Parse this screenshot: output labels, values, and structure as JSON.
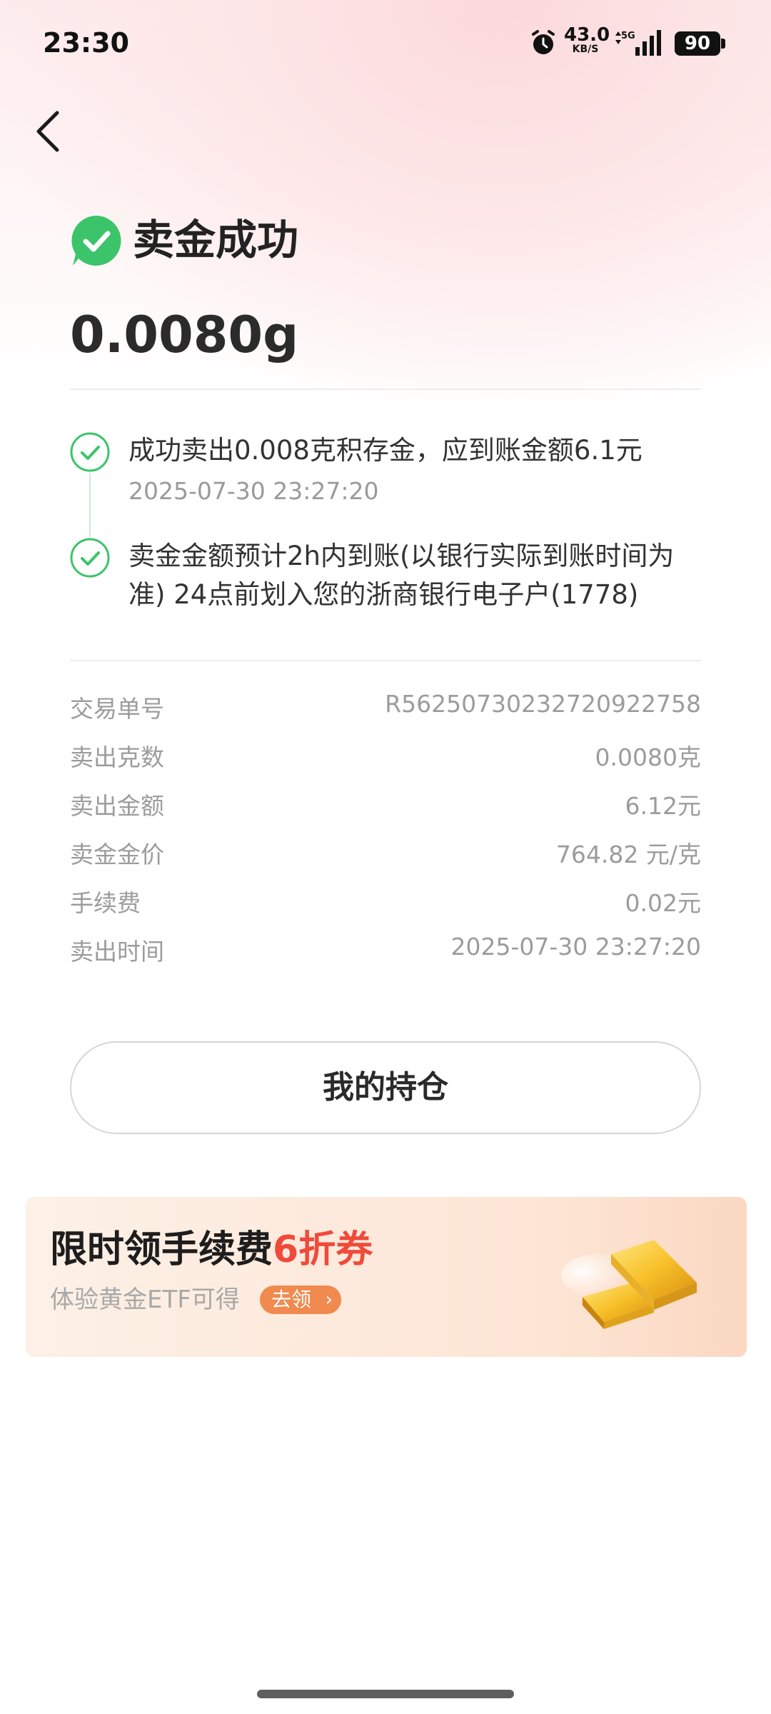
{
  "status_bar": {
    "time": "23:30",
    "net_speed_value": "43.0",
    "net_speed_unit": "KB/S",
    "network_type": "5G",
    "battery": "90"
  },
  "header": {
    "back_icon": "chevron-left-icon"
  },
  "result": {
    "title": "卖金成功",
    "icon": "check-circle-icon",
    "amount": "0.0080g"
  },
  "steps": [
    {
      "text": "成功卖出0.008克积存金，应到账金额6.1元",
      "time": "2025-07-30 23:27:20"
    },
    {
      "text": "卖金金额预计2h内到账(以银行实际到账时间为准) 24点前划入您的浙商银行电子户(1778)"
    }
  ],
  "details": [
    {
      "label": "交易单号",
      "value": "R56250730232720922758"
    },
    {
      "label": "卖出克数",
      "value": "0.0080克"
    },
    {
      "label": "卖出金额",
      "value": "6.12元"
    },
    {
      "label": "卖金金价",
      "value": "764.82 元/克"
    },
    {
      "label": "手续费",
      "value": "0.02元"
    },
    {
      "label": "卖出时间",
      "value": "2025-07-30 23:27:20"
    }
  ],
  "actions": {
    "holdings_label": "我的持仓"
  },
  "banner": {
    "title_prefix": "限时领手续费",
    "title_highlight": "6折券",
    "subtitle": "体验黄金ETF可得",
    "button_label": "去领",
    "image": "gold-bar-icon"
  },
  "colors": {
    "success_green": "#3cc46a",
    "highlight_red": "#f04a3a",
    "banner_button": "#f08a4e"
  }
}
